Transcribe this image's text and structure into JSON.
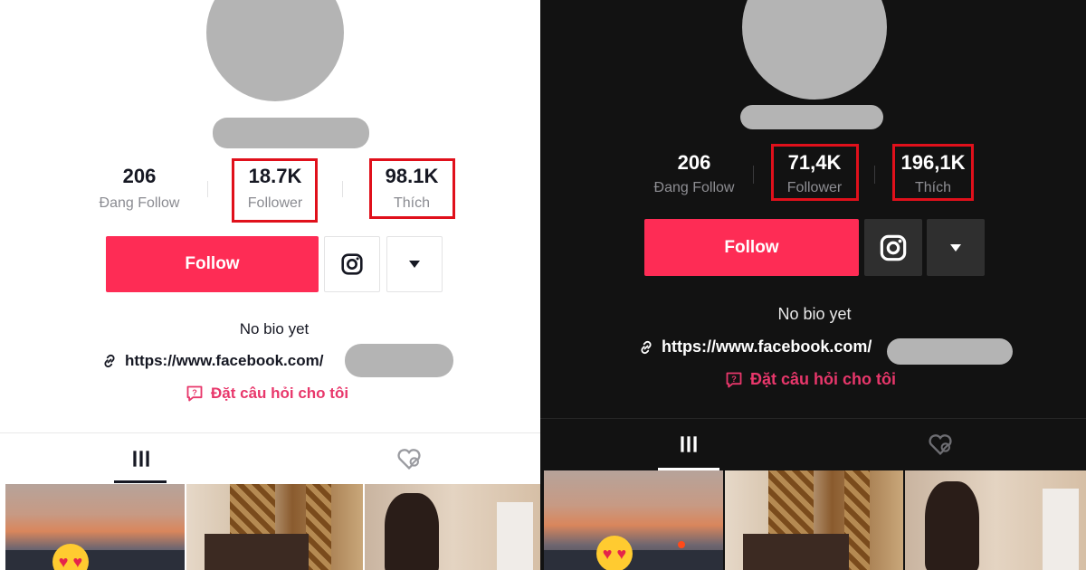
{
  "light": {
    "stats": {
      "following_count": "206",
      "following_label": "Đang Follow",
      "followers_count": "18.7K",
      "followers_label": "Follower",
      "likes_count": "98.1K",
      "likes_label": "Thích"
    },
    "follow_button": "Follow",
    "bio": "No bio yet",
    "link_text": "https://www.facebook.com/",
    "ask_text": "Đặt câu hỏi cho tôi"
  },
  "dark": {
    "stats": {
      "following_count": "206",
      "following_label": "Đang Follow",
      "followers_count": "71,4K",
      "followers_label": "Follower",
      "likes_count": "196,1K",
      "likes_label": "Thích"
    },
    "follow_button": "Follow",
    "bio": "No bio yet",
    "link_text": "https://www.facebook.com/",
    "ask_text": "Đặt câu hỏi cho tôi"
  },
  "icons": {
    "instagram": "instagram-icon",
    "dropdown": "caret-down-icon",
    "link": "link-icon",
    "ask": "question-box-icon",
    "videos_tab": "grid-icon",
    "liked_tab": "hidden-heart-icon"
  },
  "colors": {
    "accent": "#fe2c55",
    "highlight_box": "#e0101b",
    "ask_text": "#e8376b",
    "dark_bg": "#121212"
  }
}
